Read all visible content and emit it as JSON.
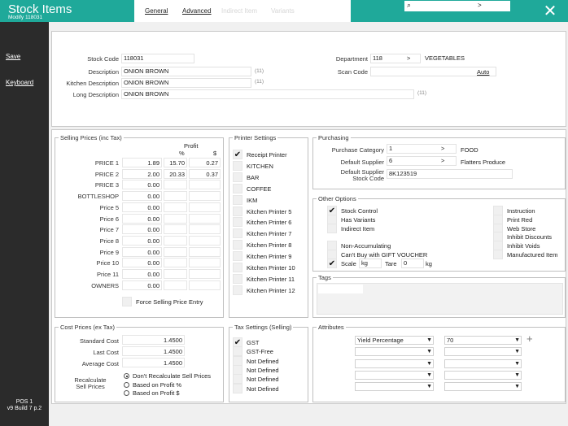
{
  "app": {
    "title": "Stock Items",
    "subtitle": "Modify 118031"
  },
  "tabs": [
    {
      "label": "General"
    },
    {
      "label": "Advanced"
    },
    {
      "label": "Indirect Item"
    },
    {
      "label": "Variants"
    }
  ],
  "search": {
    "arrow": ">"
  },
  "sidebar": {
    "save": "Save",
    "keyboard": "Keyboard",
    "pos_line1": "POS 1",
    "pos_line2": "v9 Build 7 p.2"
  },
  "details": {
    "stock_code_label": "Stock Code",
    "stock_code": "118031",
    "description_label": "Description",
    "description": "ONION BROWN",
    "description_len": "(11)",
    "kitchen_label": "Kitchen Description",
    "kitchen": "ONION BROWN",
    "kitchen_len": "(11)",
    "long_label": "Long Description",
    "long": "ONION BROWN",
    "long_len": "(11)",
    "department_label": "Department",
    "department": "118",
    "department_arrow": ">",
    "department_name": "VEGETABLES",
    "scan_label": "Scan Code",
    "scan_auto": "Auto"
  },
  "selling": {
    "title": "Selling Prices (inc Tax)",
    "profit_header": "Profit",
    "pct": "%",
    "dollar": "$",
    "rows": [
      {
        "label": "PRICE 1",
        "price": "1.89",
        "pct": "15.70",
        "profit": "0.27"
      },
      {
        "label": "PRICE 2",
        "price": "2.00",
        "pct": "20.33",
        "profit": "0.37"
      },
      {
        "label": "PRICE 3",
        "price": "0.00",
        "pct": "",
        "profit": ""
      },
      {
        "label": "BOTTLESHOP",
        "price": "0.00",
        "pct": "",
        "profit": ""
      },
      {
        "label": "Price 5",
        "price": "0.00",
        "pct": "",
        "profit": ""
      },
      {
        "label": "Price 6",
        "price": "0.00",
        "pct": "",
        "profit": ""
      },
      {
        "label": "Price 7",
        "price": "0.00",
        "pct": "",
        "profit": ""
      },
      {
        "label": "Price 8",
        "price": "0.00",
        "pct": "",
        "profit": ""
      },
      {
        "label": "Price 9",
        "price": "0.00",
        "pct": "",
        "profit": ""
      },
      {
        "label": "Price 10",
        "price": "0.00",
        "pct": "",
        "profit": ""
      },
      {
        "label": "Price 11",
        "price": "0.00",
        "pct": "",
        "profit": ""
      },
      {
        "label": "OWNERS",
        "price": "0.00",
        "pct": "",
        "profit": ""
      }
    ],
    "force_label": "Force Selling Price Entry"
  },
  "printers": {
    "title": "Printer Settings",
    "items": [
      {
        "label": "Receipt Printer",
        "checked": true
      },
      {
        "label": "KITCHEN",
        "checked": false
      },
      {
        "label": "BAR",
        "checked": false
      },
      {
        "label": "COFFEE",
        "checked": false
      },
      {
        "label": "IKM",
        "checked": false
      },
      {
        "label": "Kitchen Printer 5",
        "checked": false
      },
      {
        "label": "Kitchen Printer 6",
        "checked": false
      },
      {
        "label": "Kitchen Printer 7",
        "checked": false
      },
      {
        "label": "Kitchen Printer 8",
        "checked": false
      },
      {
        "label": "Kitchen Printer 9",
        "checked": false
      },
      {
        "label": "Kitchen Printer 10",
        "checked": false
      },
      {
        "label": "Kitchen Printer 11",
        "checked": false
      },
      {
        "label": "Kitchen Printer 12",
        "checked": false
      }
    ]
  },
  "purchasing": {
    "title": "Purchasing",
    "category_label": "Purchase Category",
    "category": "1",
    "category_arrow": ">",
    "category_name": "FOOD",
    "supplier_label": "Default Supplier",
    "supplier": "6",
    "supplier_arrow": ">",
    "supplier_name": "Flatters Produce",
    "supplier_code_label1": "Default Supplier",
    "supplier_code_label2": "Stock Code",
    "supplier_code": "8K123519"
  },
  "options": {
    "title": "Other Options",
    "left": [
      {
        "label": "Stock Control",
        "checked": true
      },
      {
        "label": "Has Variants",
        "checked": false
      },
      {
        "label": "Indirect Item",
        "checked": false
      }
    ],
    "left2": [
      {
        "label": "Non-Accumulating",
        "checked": false
      },
      {
        "label": "Can't Buy with GIFT VOUCHER",
        "checked": false
      }
    ],
    "scale_label": "Scale",
    "scale_checked": true,
    "scale_unit": "kg",
    "tare_label": "Tare",
    "tare_value": "0",
    "tare_unit": "kg",
    "right": [
      {
        "label": "Instruction",
        "checked": false
      },
      {
        "label": "Print Red",
        "checked": false
      },
      {
        "label": "Web Store",
        "checked": false
      },
      {
        "label": "Inhibit Discounts",
        "checked": false
      },
      {
        "label": "Inhibit Voids",
        "checked": false
      },
      {
        "label": "Manufactured Item",
        "checked": false
      }
    ]
  },
  "tags": {
    "title": "Tags"
  },
  "cost": {
    "title": "Cost Prices (ex Tax)",
    "standard_label": "Standard Cost",
    "standard": "1.4500",
    "last_label": "Last Cost",
    "last": "1.4500",
    "average_label": "Average Cost",
    "average": "1.4500",
    "recalc_label1": "Recalculate",
    "recalc_label2": "Sell Prices",
    "radios": [
      {
        "label": "Don't Recalculate Sell Prices",
        "selected": true
      },
      {
        "label": "Based on Profit %",
        "selected": false
      },
      {
        "label": "Based on Profit $",
        "selected": false
      }
    ]
  },
  "tax": {
    "title": "Tax Settings (Selling)",
    "items": [
      {
        "label": "GST",
        "checked": true
      },
      {
        "label": "GST-Free",
        "checked": false
      },
      {
        "label": "Not Defined",
        "checked": false
      },
      {
        "label": "Not Defined",
        "checked": false
      },
      {
        "label": "Not Defined",
        "checked": false
      },
      {
        "label": "Not Defined",
        "checked": false
      }
    ]
  },
  "attributes": {
    "title": "Attributes",
    "first_name": "Yield Percentage",
    "first_value": "70",
    "add": "+"
  }
}
